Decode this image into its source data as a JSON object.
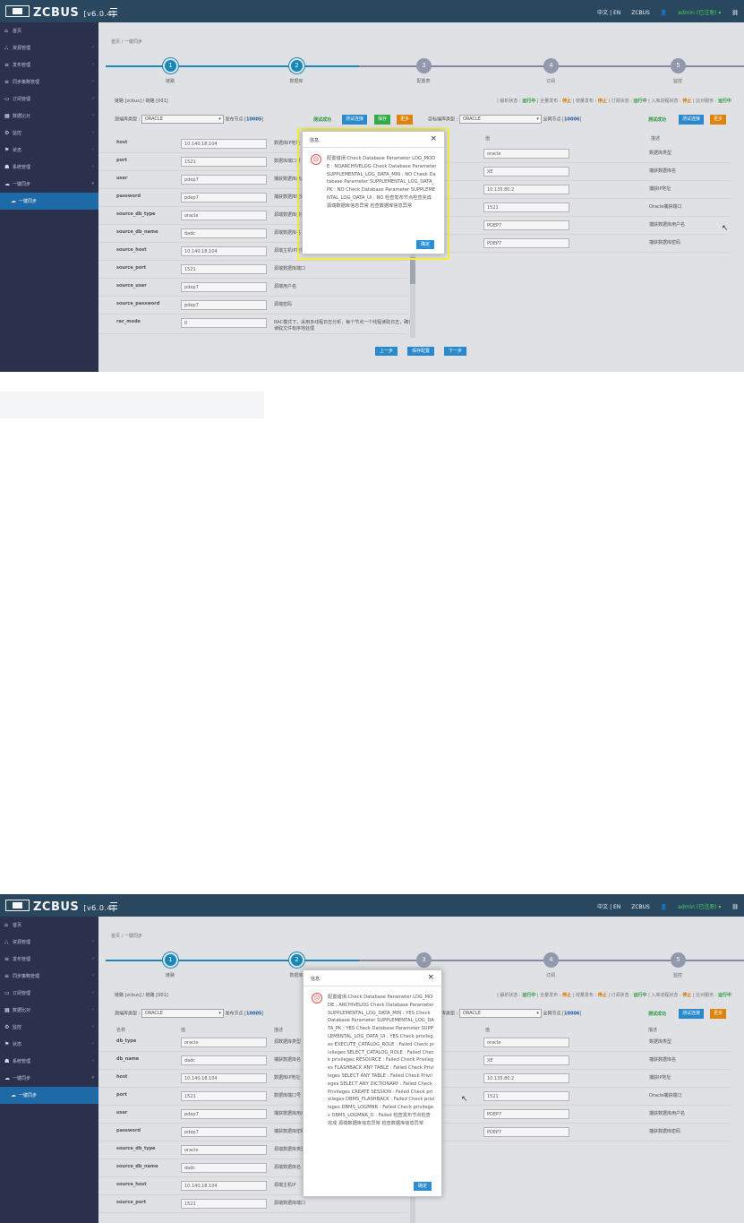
{
  "app": {
    "brand": "ZCBUS",
    "version": "[v6.0.4]",
    "lang": "中文 | EN",
    "user_org": "ZCBUS",
    "user": "admin (已注册) ▾"
  },
  "sidebar": {
    "items": [
      {
        "label": "首页",
        "icon": "home-icon",
        "arrow": ""
      },
      {
        "label": "资源管理",
        "icon": "sitemap-icon",
        "arrow": "‹"
      },
      {
        "label": "发布管理",
        "icon": "list-icon",
        "arrow": "‹"
      },
      {
        "label": "同步策略管理",
        "icon": "list-icon",
        "arrow": "‹"
      },
      {
        "label": "订阅管理",
        "icon": "monitor-icon",
        "arrow": "‹"
      },
      {
        "label": "数据比对",
        "icon": "grid-icon",
        "arrow": "‹"
      },
      {
        "label": "监控",
        "icon": "gear-icon",
        "arrow": "‹"
      },
      {
        "label": "状态",
        "icon": "flag-icon",
        "arrow": "‹"
      },
      {
        "label": "系统管理",
        "icon": "user-icon",
        "arrow": "‹"
      },
      {
        "label": "一键同步",
        "icon": "cloud-icon",
        "arrow": "▾"
      },
      {
        "label": "一键同步",
        "icon": "cloud-icon",
        "arrow": "",
        "active": true
      }
    ]
  },
  "breadcrumb": "首页 / 一键同步",
  "steps": [
    {
      "num": "1",
      "label": "链路"
    },
    {
      "num": "2",
      "label": "数据库"
    },
    {
      "num": "3",
      "label": "配置表"
    },
    {
      "num": "4",
      "label": "订阅"
    },
    {
      "num": "5",
      "label": "监控"
    }
  ],
  "status": {
    "left": "链路 [zcbus] / 链路 [001]",
    "right": [
      {
        "t": "| 解析状态 : ",
        "v": "运行中",
        "c": "g"
      },
      {
        "t": " | 全量发布 : ",
        "v": "停止",
        "c": "o"
      },
      {
        "t": " | 增量发布 : ",
        "v": "停止",
        "c": "o"
      },
      {
        "t": " | 订阅状态 : ",
        "v": "运行中",
        "c": "g"
      },
      {
        "t": " | 入库进程状态 : ",
        "v": "停止",
        "c": "o"
      },
      {
        "t": " | 比对服务 : ",
        "v": "运行中",
        "c": "g"
      }
    ]
  },
  "source": {
    "type_label": "源端库类型 :",
    "type_value": "ORACLE",
    "node": "发布节点 [",
    "node_num": "10005",
    "node_end": "]",
    "test_ok": "测试成功",
    "test_btn": "测试连接",
    "save_btn": "保存",
    "more_btn": "更多"
  },
  "target": {
    "type_label": "目标端库类型 :",
    "type_value": "ORACLE",
    "node": "全网节点 [",
    "node_num": "10006",
    "node_end": "]",
    "test_ok": "测试成功",
    "test_btn": "测试连接",
    "more_btn": "更多"
  },
  "left_fields_1": [
    {
      "label": "host",
      "value": "10.140.18.104",
      "desc": "数据库IP地址"
    },
    {
      "label": "port",
      "value": "1521",
      "desc": "数据库端口号"
    },
    {
      "label": "user",
      "value": "pdep7",
      "desc": "捕获数据库用户名"
    },
    {
      "label": "password",
      "value": "pdep7",
      "desc": "捕获数据库密码"
    },
    {
      "label": "source_db_type",
      "value": "oracle",
      "desc": "源端数据库类型"
    },
    {
      "label": "source_db_name",
      "value": "dadc",
      "desc": "源端数据库名"
    },
    {
      "label": "source_host",
      "value": "10.140.18.104",
      "desc": "源端主机IP地址"
    },
    {
      "label": "source_port",
      "value": "1521",
      "desc": "源端数据库端口"
    },
    {
      "label": "source_user",
      "value": "pdep7",
      "desc": "源端用户名"
    },
    {
      "label": "source_password",
      "value": "pdep7",
      "desc": "源端密码"
    },
    {
      "label": "rac_mode",
      "value": "0",
      "desc": "RAC模式下，采用多线程日志分析，每个节点一个线程读取日志，确保读取文件有序地处理"
    }
  ],
  "left_fields_2": [
    {
      "label": "db_type",
      "value": "oracle",
      "desc": "源数据库类型"
    },
    {
      "label": "db_name",
      "value": "dadc",
      "desc": "捕获数据库名"
    },
    {
      "label": "host",
      "value": "10.140.18.104",
      "desc": "数据库IP地址"
    },
    {
      "label": "port",
      "value": "1521",
      "desc": "数据库端口号"
    },
    {
      "label": "user",
      "value": "pdep7",
      "desc": "捕获数据库用户名"
    },
    {
      "label": "password",
      "value": "pdep7",
      "desc": "捕获数据库密码"
    },
    {
      "label": "source_db_type",
      "value": "oracle",
      "desc": "源端数据库类型"
    },
    {
      "label": "source_db_name",
      "value": "dadc",
      "desc": "源端数据库名"
    },
    {
      "label": "source_host",
      "value": "10.140.18.104",
      "desc": "源端主机IP"
    },
    {
      "label": "source_port",
      "value": "1521",
      "desc": "源端数据库端口"
    }
  ],
  "headers": {
    "name": "名称",
    "value": "值",
    "desc": "描述"
  },
  "right_fields": [
    {
      "label": "type",
      "value": "oracle",
      "desc": "数据库类型"
    },
    {
      "label": "name",
      "value": "XE",
      "desc": "捕获数据库名"
    },
    {
      "label": "",
      "value": "10.135.80.2",
      "desc": "捕获IP地址"
    },
    {
      "label": "",
      "value": "1521",
      "desc": "Oracle捕获端口"
    },
    {
      "label": "",
      "value": "PDEP7",
      "desc": "捕获数据库用户名"
    },
    {
      "label": "word",
      "value": "PDEP7",
      "desc": "捕获数据库密码"
    }
  ],
  "nav": {
    "prev": "上一步",
    "save": "保存配置",
    "next": "下一步"
  },
  "modal1": {
    "title": "信息",
    "msg": "配置错误:Check Database Parameter LOG_MODE : NOARCHIVELOG Check Database Parameter SUPPLEMENTAL_LOG_DATA_MIN : NO Check Database Parameter SUPPLEMENTAL_LOG_DATA_PK : NO Check Database Parameter SUPPLEMENTAL_LOG_DATA_UI : NO 检查发布节点检查完成 源端数据库信息异常 检查数据库信息异常",
    "ok": "确定"
  },
  "modal2": {
    "title": "信息",
    "msg": "配置错误:Check Database Parameter LOG_MODE : ARCHIVELOG Check Database Parameter SUPPLEMENTAL_LOG_DATA_MIN : YES Check Database Parameter SUPPLEMENTAL_LOG_DATA_PK : YES Check Database Parameter SUPPLEMENTAL_LOG_DATA_UI : YES Check privileges EXECUTE_CATALOG_ROLE : Failed Check privileges SELECT_CATALOG_ROLE : Failed Check privileges RESOURCE : Failed Check Privileges FLASHBACK ANY TABLE : Failed Check Privileges SELECT ANY TABLE : Failed Check Privileges SELECT ANY DICTIONARY : Failed Check Privileges CREATE SESSION : Failed Check privileges DBMS_FLASHBACK : Failed Check privileges DBMS_LOGMNR : Failed Check privileges DBMS_LOGMNR_D : Failed 检查发布节点检查完成 源端数据库信息异常 检查数据库信息异常",
    "ok": "确定"
  },
  "colors": {
    "topbar": "#2b4a63",
    "sidebar": "#2d3350",
    "accent": "#2b8fd6",
    "success": "#2ea043",
    "warning": "#e88a0e"
  }
}
